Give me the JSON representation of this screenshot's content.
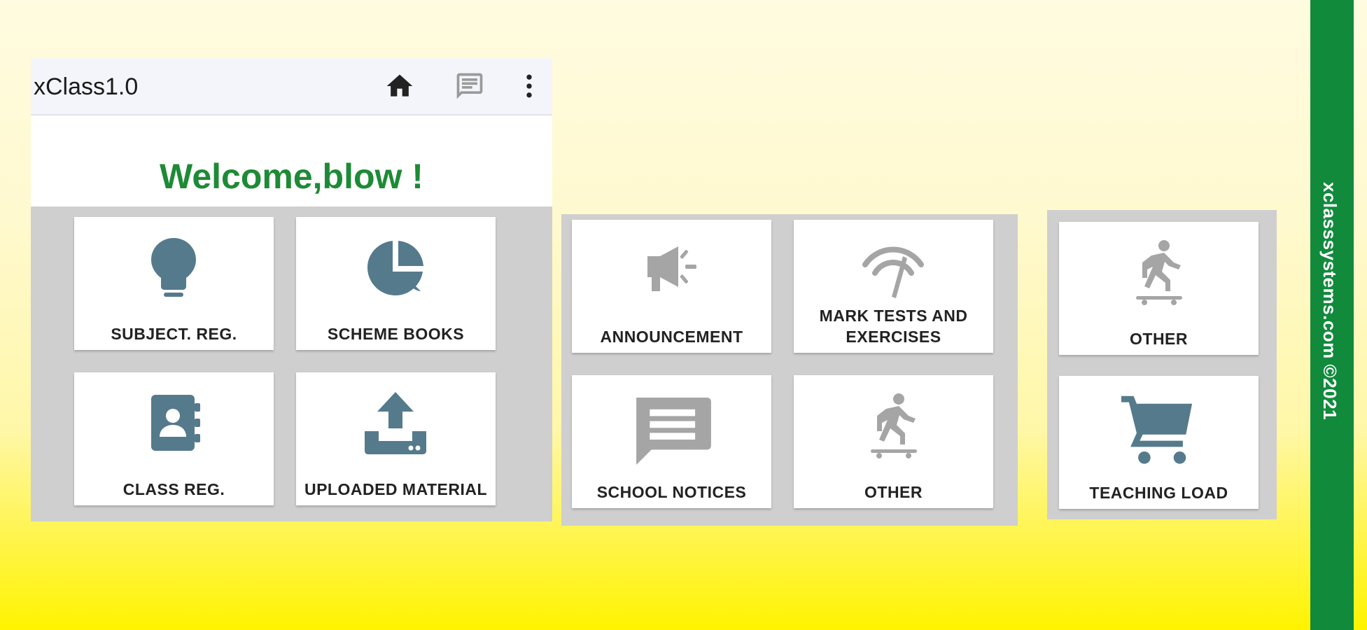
{
  "app": {
    "title": "xClass1.0",
    "welcome": "Welcome,blow !"
  },
  "toolbar": {
    "icons": [
      "home-icon",
      "message-icon",
      "more-vert-icon"
    ]
  },
  "tiles": {
    "subject_reg": "SUBJECT. REG.",
    "scheme_books": "SCHEME BOOKS",
    "class_reg": "CLASS REG.",
    "uploaded_material": "UPLOADED MATERIAL",
    "announcement": "ANNOUNCEMENT",
    "mark_tests": "MARK TESTS AND EXERCISES",
    "school_notices": "SCHOOL NOTICES",
    "other_1": "OTHER",
    "other_2": "OTHER",
    "teaching_load": "TEACHING LOAD"
  },
  "credit": "xclasssystems.com ©2021",
  "colors": {
    "accent_green": "#1e8a36",
    "sidebar_green": "#118a3c",
    "icon_blue_gray": "#557a8c",
    "icon_gray": "#a5a5a5",
    "panel_gray": "#cfcfcf"
  }
}
